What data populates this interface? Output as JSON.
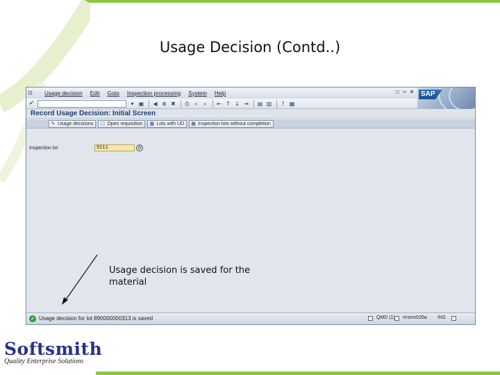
{
  "slide": {
    "title": "Usage Decision (Contd..)",
    "annotation": "Usage decision is saved for the material",
    "logo_name": "Softsmith",
    "logo_tagline": "Quality Enterprise Solutions"
  },
  "sap": {
    "menu": [
      "Usage decision",
      "Edit",
      "Goto",
      "Inspection processing",
      "System",
      "Help"
    ],
    "window_controls": "□ ▭ ⊠",
    "logo_text": "SAP",
    "screen_title": "Record Usage Decision: Initial Screen",
    "app_buttons": [
      {
        "icon": "usage-decision-icon",
        "label": "Usage decisions"
      },
      {
        "icon": "open-requisition-icon",
        "label": "Open requisition"
      },
      {
        "icon": "lots-icon",
        "label": "Lots with UD"
      },
      {
        "icon": "defects-icon",
        "label": "Inspection lots without completion"
      }
    ],
    "field": {
      "label": "Inspection lot",
      "value": "9111"
    },
    "status": {
      "message": "Usage decision for lot 890000000313 is saved",
      "system": "QMD (1)",
      "client": "nrsmv026a",
      "mode": "INS"
    }
  },
  "colors": {
    "accent_green": "#8dc63f",
    "sap_title_blue": "#1c3e75",
    "logo_blue": "#2a2f8a"
  }
}
